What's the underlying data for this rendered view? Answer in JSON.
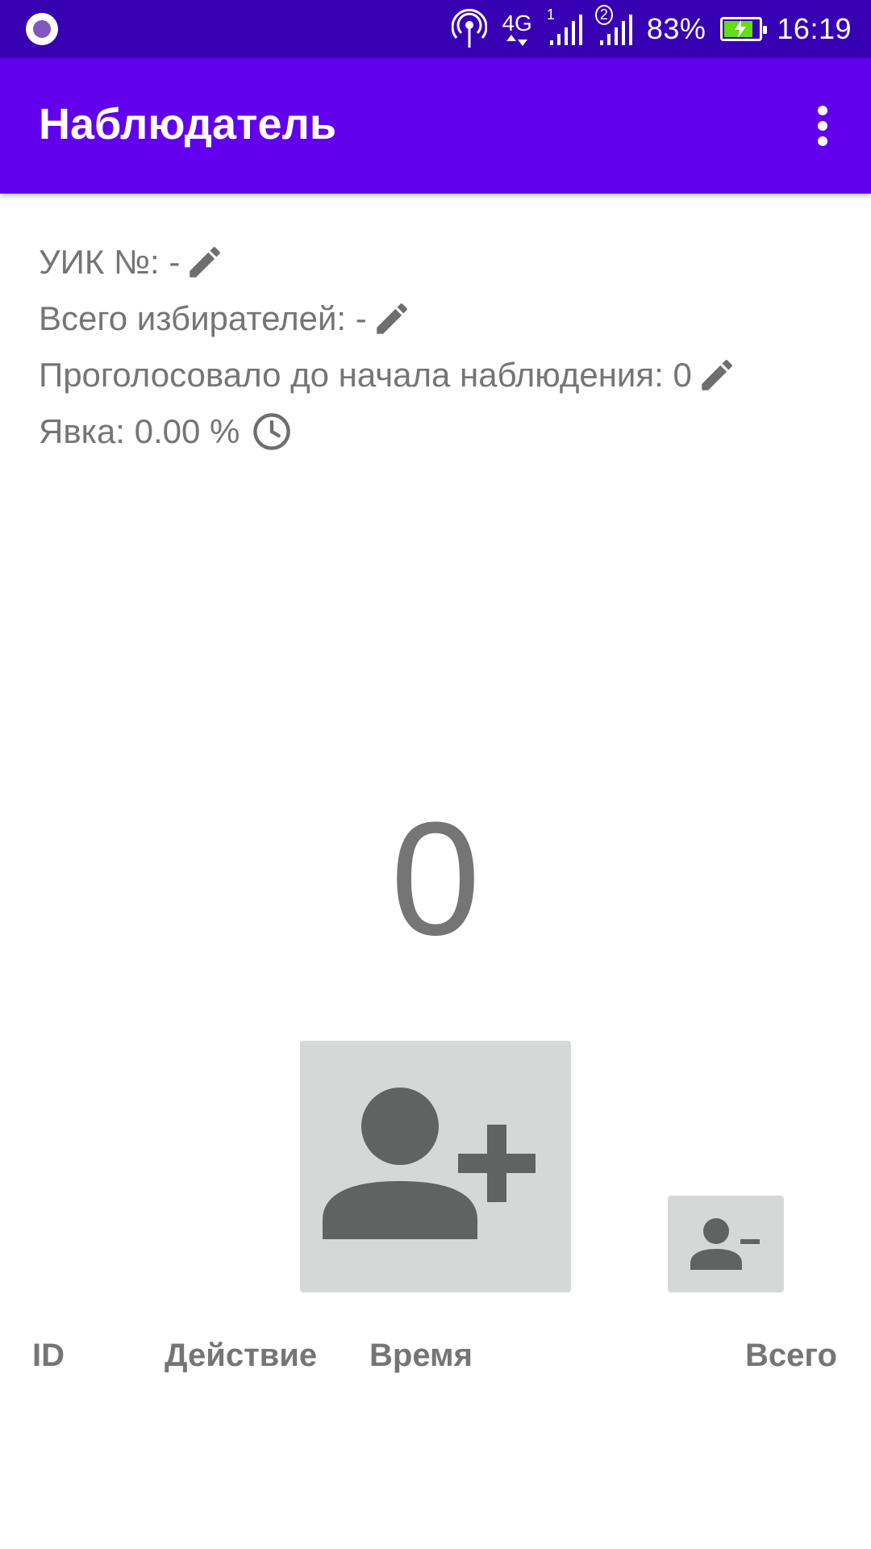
{
  "status_bar": {
    "network": "4G",
    "sim1": "1",
    "sim2": "2",
    "battery_percent_text": "83%",
    "battery_level": 0.83,
    "time": "16:19",
    "icons": [
      "notification-dot-icon",
      "hotspot-icon",
      "4g-icon",
      "signal-sim1-icon",
      "signal-sim2-icon",
      "battery-charging-icon"
    ]
  },
  "app_bar": {
    "title": "Наблюдатель",
    "menu_icon": "more-vert-icon"
  },
  "info": {
    "uik": {
      "label": "УИК №:",
      "value": "-",
      "icon": "edit-icon"
    },
    "voters_total": {
      "label": "Всего избирателей:",
      "value": "-",
      "icon": "edit-icon"
    },
    "voted_before": {
      "label": "Проголосовало до начала наблюдения:",
      "value": "0",
      "icon": "edit-icon"
    },
    "turnout": {
      "label": "Явка:",
      "value": "0.00 %",
      "icon": "clock-icon"
    }
  },
  "counter": {
    "value": "0"
  },
  "buttons": {
    "add_voter": {
      "icon": "person-add-icon"
    },
    "remove_voter": {
      "icon": "person-remove-icon"
    }
  },
  "table": {
    "columns": [
      "ID",
      "Действие",
      "Время",
      "Всего"
    ],
    "rows": []
  },
  "colors": {
    "status_bar": "#3700b3",
    "app_bar": "#6200ee",
    "text_gray": "#757575",
    "button_bg": "#d6d7d7",
    "icon_dark": "#616262",
    "battery_green": "#64dd17"
  }
}
